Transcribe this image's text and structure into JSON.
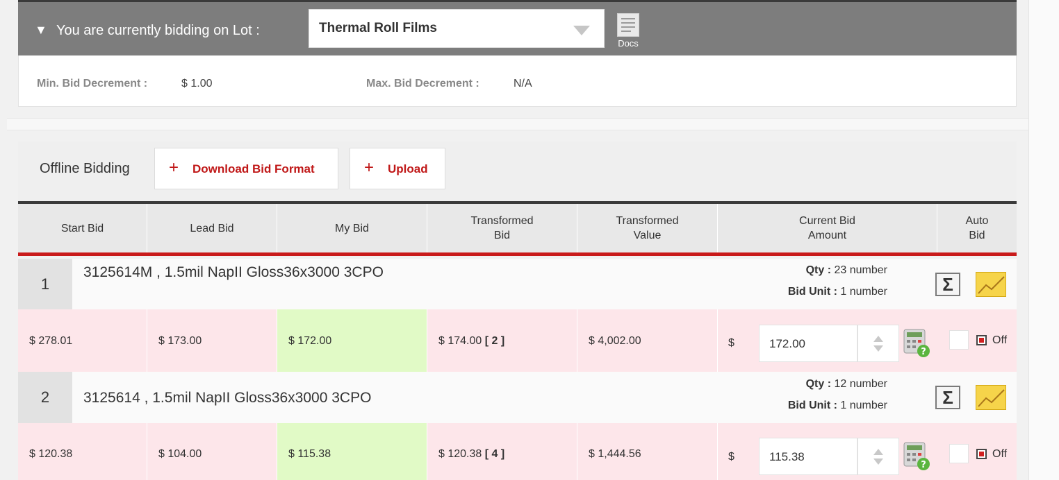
{
  "lot_bar": {
    "caret": "▼",
    "label": "You are currently bidding on Lot :",
    "selected_lot": "Thermal Roll Films",
    "docs_label": "Docs"
  },
  "decrements": {
    "min_label": "Min. Bid Decrement :",
    "min_value": "$ 1.00",
    "max_label": "Max. Bid Decrement :",
    "max_value": "N/A"
  },
  "offline": {
    "label": "Offline Bidding",
    "download_label": "Download Bid Format",
    "upload_label": "Upload",
    "plus": "+"
  },
  "columns": {
    "start_bid": "Start Bid",
    "lead_bid": "Lead Bid",
    "my_bid": "My Bid",
    "transformed_bid_1": "Transformed",
    "transformed_bid_2": "Bid",
    "transformed_value_1": "Transformed",
    "transformed_value_2": "Value",
    "current_bid_1": "Current Bid",
    "current_bid_2": "Amount",
    "auto_bid_1": "Auto",
    "auto_bid_2": "Bid"
  },
  "items": [
    {
      "num": "1",
      "description": "3125614M , 1.5mil NapII Gloss36x3000 3CPO",
      "qty_label": "Qty :",
      "qty_value": "23 number",
      "unit_label": "Bid Unit :",
      "unit_value": "1 number",
      "start_bid": "$ 278.01",
      "lead_bid": "$ 173.00",
      "my_bid": "$ 172.00",
      "transformed_bid": "$ 174.00",
      "transformed_rank": "[ 2 ]",
      "transformed_value": "$ 4,002.00",
      "currency": "$",
      "current_bid": "172.00",
      "auto_bid": "Off"
    },
    {
      "num": "2",
      "description": "3125614 , 1.5mil NapII Gloss36x3000 3CPO",
      "qty_label": "Qty :",
      "qty_value": "12 number",
      "unit_label": "Bid Unit :",
      "unit_value": "1 number",
      "start_bid": "$ 120.38",
      "lead_bid": "$ 104.00",
      "my_bid": "$ 115.38",
      "transformed_bid": "$ 120.38",
      "transformed_rank": "[ 4 ]",
      "transformed_value": "$ 1,444.56",
      "currency": "$",
      "current_bid": "115.38",
      "auto_bid": "Off"
    }
  ],
  "sigma_glyph": "Σ",
  "colors": {
    "accent_red": "#c91a1a",
    "lot_bar": "#7d7d7d",
    "row_pink": "#fde6ea",
    "my_bid_green": "#e1fac6",
    "chart_yellow": "#f6d44a"
  }
}
